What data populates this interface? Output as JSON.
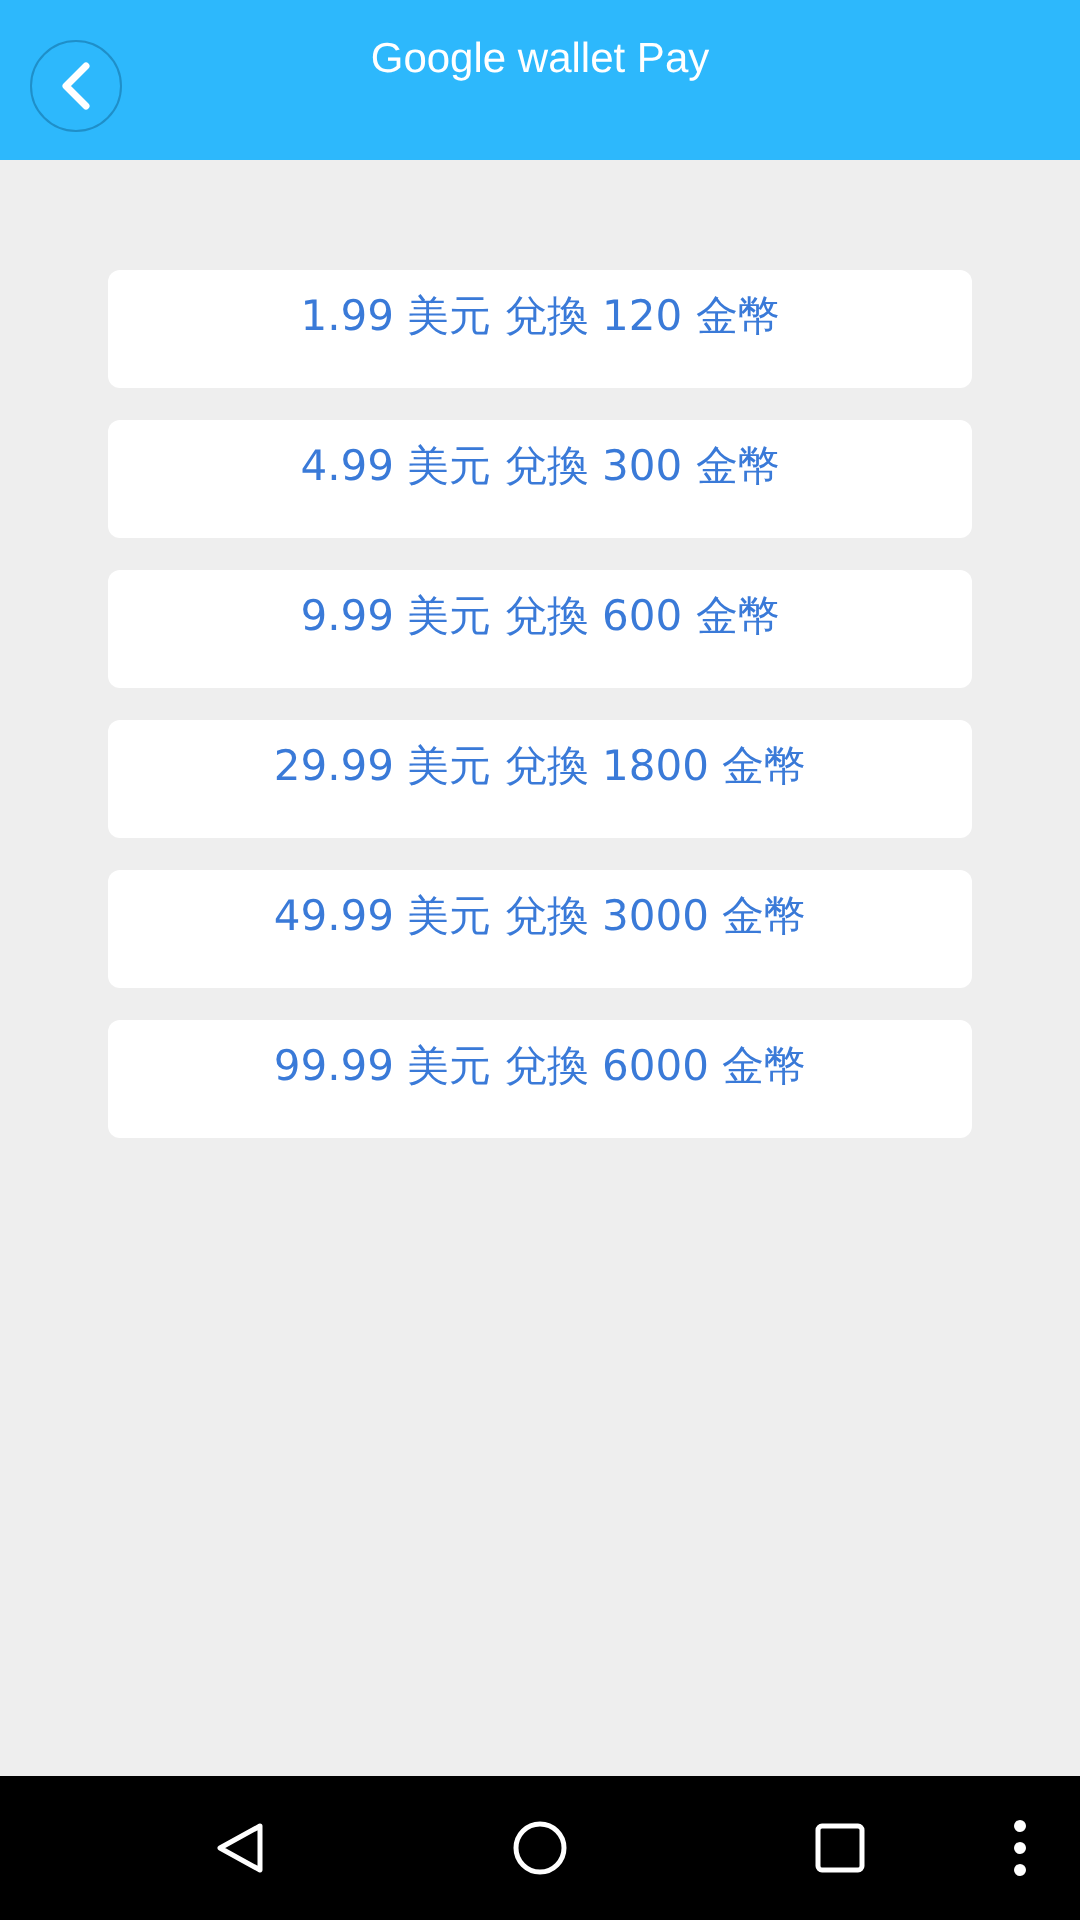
{
  "header": {
    "title": "Google wallet Pay"
  },
  "options": [
    {
      "label": "1.99 美元 兌換 120 金幣"
    },
    {
      "label": "4.99 美元 兌換 300 金幣"
    },
    {
      "label": "9.99 美元 兌換 600 金幣"
    },
    {
      "label": "29.99 美元 兌換 1800 金幣"
    },
    {
      "label": "49.99 美元 兌換 3000 金幣"
    },
    {
      "label": "99.99 美元 兌換 6000 金幣"
    }
  ]
}
